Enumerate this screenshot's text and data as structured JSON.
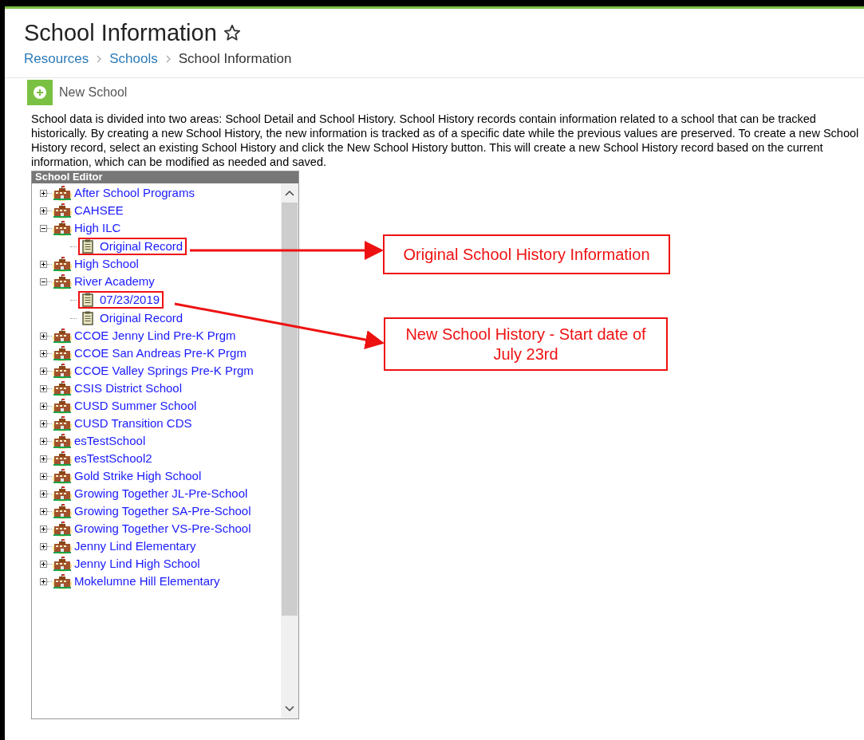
{
  "header": {
    "title": "School Information",
    "favorite": false
  },
  "breadcrumb": [
    {
      "label": "Resources",
      "link": true
    },
    {
      "label": "Schools",
      "link": true
    },
    {
      "label": "School Information",
      "link": false
    }
  ],
  "new_button": "New School",
  "description": "School data is divided into two areas: School Detail and School History. School History records contain information related to a school that can be tracked historically. By creating a new School History, the new information is tracked as of a specific date while the previous values are preserved. To create a new School History record, select an existing School History and click the New School History button. This will create a new School History record based on the current information, which can be modified as needed and saved.",
  "tree": {
    "title": "School Editor",
    "items": [
      {
        "label": "After School Programs",
        "expanded": false
      },
      {
        "label": "CAHSEE",
        "expanded": false
      },
      {
        "label": "High ILC",
        "expanded": true,
        "children": [
          {
            "label": "Original Record",
            "annotated": true
          }
        ]
      },
      {
        "label": "High School",
        "expanded": false
      },
      {
        "label": "River Academy",
        "expanded": true,
        "children": [
          {
            "label": "07/23/2019",
            "annotated": true
          },
          {
            "label": "Original Record",
            "annotated": false
          }
        ]
      },
      {
        "label": "CCOE Jenny Lind Pre-K Prgm",
        "expanded": false
      },
      {
        "label": "CCOE San Andreas Pre-K Prgm",
        "expanded": false
      },
      {
        "label": "CCOE Valley Springs Pre-K Prgm",
        "expanded": false
      },
      {
        "label": "CSIS District School",
        "expanded": false
      },
      {
        "label": "CUSD Summer School",
        "expanded": false
      },
      {
        "label": "CUSD Transition CDS",
        "expanded": false
      },
      {
        "label": "esTestSchool",
        "expanded": false
      },
      {
        "label": "esTestSchool2",
        "expanded": false
      },
      {
        "label": "Gold Strike High School",
        "expanded": false
      },
      {
        "label": "Growing Together JL-Pre-School",
        "expanded": false
      },
      {
        "label": "Growing Together SA-Pre-School",
        "expanded": false
      },
      {
        "label": "Growing Together VS-Pre-School",
        "expanded": false
      },
      {
        "label": "Jenny Lind Elementary",
        "expanded": false
      },
      {
        "label": "Jenny Lind High School",
        "expanded": false
      },
      {
        "label": "Mokelumne Hill Elementary",
        "expanded": false
      }
    ]
  },
  "callouts": [
    {
      "text": "Original School History Information"
    },
    {
      "text": "New School History - Start date of July 23rd"
    }
  ]
}
